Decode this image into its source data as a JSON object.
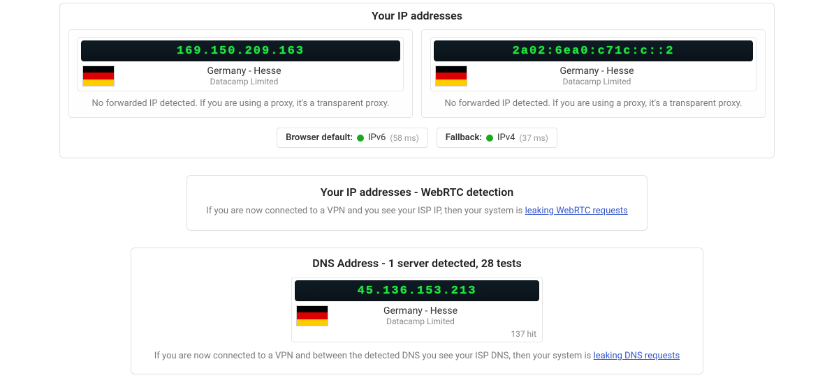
{
  "ip_section": {
    "title": "Your IP addresses",
    "columns": [
      {
        "ip": "169.150.209.163",
        "location": "Germany - Hesse",
        "isp": "Datacamp Limited",
        "note": "No forwarded IP detected. If you are using a proxy, it's a transparent proxy."
      },
      {
        "ip": "2a02:6ea0:c71c:c::2",
        "location": "Germany - Hesse",
        "isp": "Datacamp Limited",
        "note": "No forwarded IP detected. If you are using a proxy, it's a transparent proxy."
      }
    ],
    "protocols": [
      {
        "label": "Browser default:",
        "value": "IPv6",
        "ms": "(58 ms)"
      },
      {
        "label": "Fallback:",
        "value": "IPv4",
        "ms": "(37 ms)"
      }
    ]
  },
  "webrtc_section": {
    "title": "Your IP addresses - WebRTC detection",
    "text_prefix": "If you are now connected to a VPN and you see your ISP IP, then your system is ",
    "link": "leaking WebRTC requests"
  },
  "dns_section": {
    "title": "DNS Address - 1 server detected, 28 tests",
    "server": {
      "ip": "45.136.153.213",
      "location": "Germany - Hesse",
      "isp": "Datacamp Limited",
      "hits": "137 hit"
    },
    "text_prefix": "If you are now connected to a VPN and between the detected DNS you see your ISP DNS, then your system is ",
    "link": "leaking DNS requests"
  }
}
